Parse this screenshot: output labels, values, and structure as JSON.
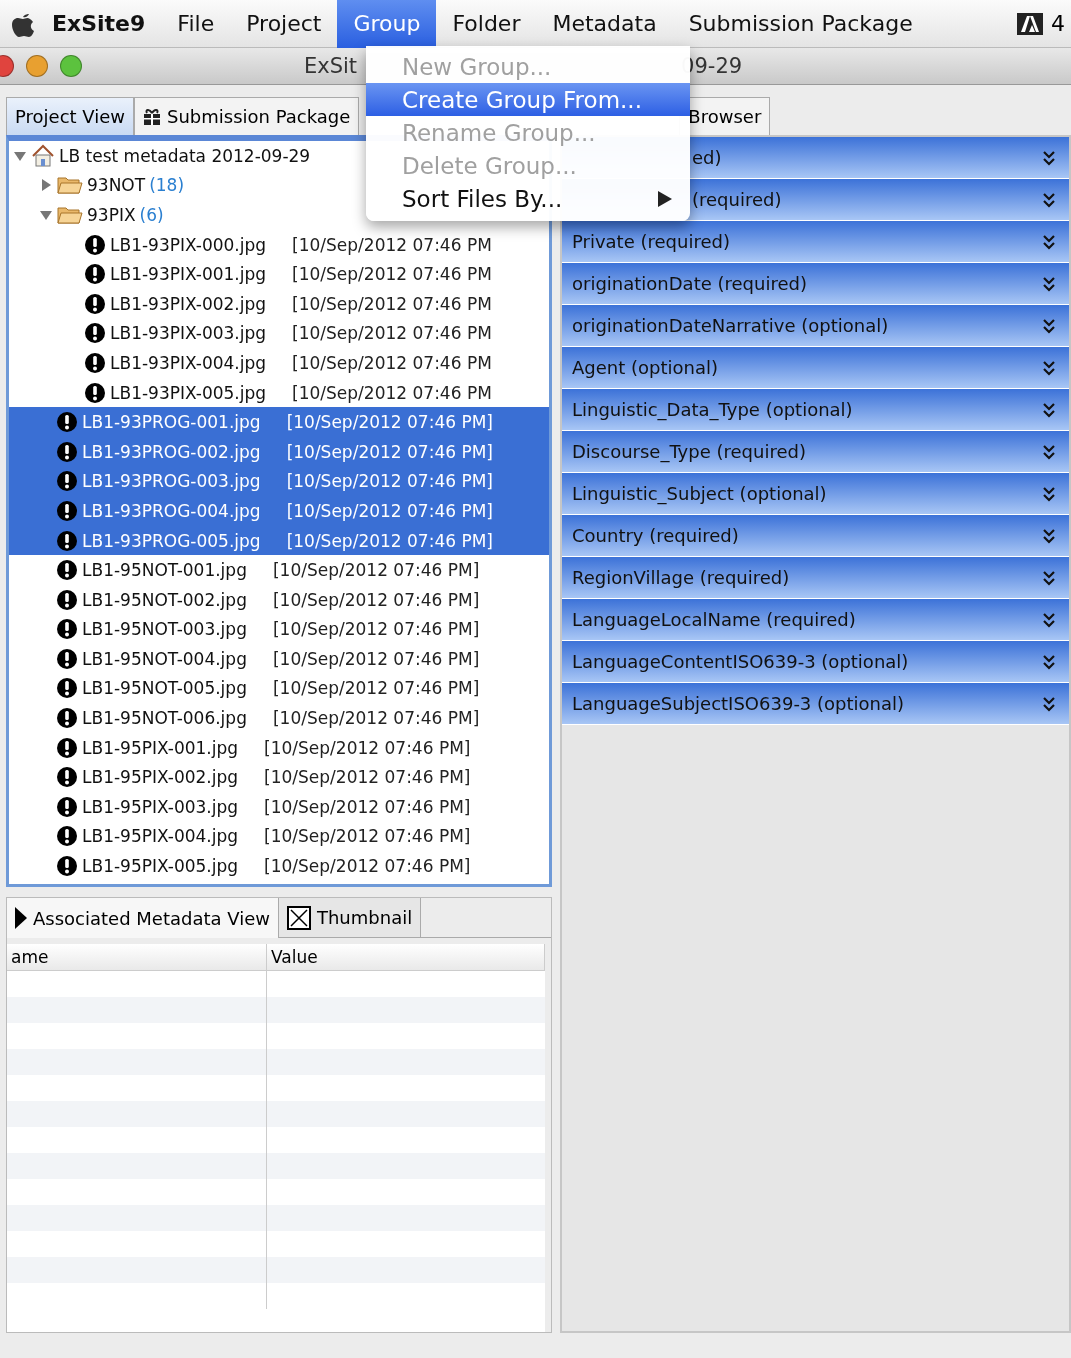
{
  "menu_bar": {
    "app_name": "ExSite9",
    "items": [
      {
        "label": "File",
        "selected": false
      },
      {
        "label": "Project",
        "selected": false
      },
      {
        "label": "Group",
        "selected": true
      },
      {
        "label": "Folder",
        "selected": false
      },
      {
        "label": "Metadata",
        "selected": false
      },
      {
        "label": "Submission Package",
        "selected": false
      }
    ],
    "status_text": "4"
  },
  "menu": {
    "items": [
      {
        "kind": "item",
        "label": "New Group...",
        "disabled": true,
        "selected": false
      },
      {
        "kind": "item",
        "label": "Create Group From...",
        "disabled": false,
        "selected": true
      },
      {
        "kind": "item",
        "label": "Rename Group...",
        "disabled": true,
        "selected": false
      },
      {
        "kind": "item",
        "label": "Delete Group...",
        "disabled": true,
        "selected": false
      },
      {
        "kind": "submenu",
        "label": "Sort Files By...",
        "disabled": false,
        "selected": false
      }
    ]
  },
  "window": {
    "title_left": "ExSit",
    "title_right": "09-29"
  },
  "tabs": [
    {
      "label": "Project View",
      "selected": true
    },
    {
      "label": "Submission Package",
      "selected": false
    },
    {
      "label": "Browser",
      "selected": false
    }
  ],
  "tree": {
    "label": "LB test metadata 2012-09-29",
    "expanded": true,
    "children": [
      {
        "kind": "folder",
        "label": "93NOT",
        "count": "(18)",
        "expanded": false
      },
      {
        "kind": "folder",
        "label": "93PIX",
        "count": "(6)",
        "expanded": true,
        "children": [
          {
            "kind": "file",
            "label": "LB1-93PIX-000.jpg",
            "date": "[10/Sep/2012 07:46 PM",
            "selected": false
          },
          {
            "kind": "file",
            "label": "LB1-93PIX-001.jpg",
            "date": "[10/Sep/2012 07:46 PM",
            "selected": false
          },
          {
            "kind": "file",
            "label": "LB1-93PIX-002.jpg",
            "date": "[10/Sep/2012 07:46 PM",
            "selected": false
          },
          {
            "kind": "file",
            "label": "LB1-93PIX-003.jpg",
            "date": "[10/Sep/2012 07:46 PM",
            "selected": false
          },
          {
            "kind": "file",
            "label": "LB1-93PIX-004.jpg",
            "date": "[10/Sep/2012 07:46 PM",
            "selected": false
          },
          {
            "kind": "file",
            "label": "LB1-93PIX-005.jpg",
            "date": "[10/Sep/2012 07:46 PM",
            "selected": false
          }
        ]
      },
      {
        "kind": "file",
        "label": "LB1-93PROG-001.jpg",
        "date": "[10/Sep/2012 07:46 PM]",
        "selected": true
      },
      {
        "kind": "file",
        "label": "LB1-93PROG-002.jpg",
        "date": "[10/Sep/2012 07:46 PM]",
        "selected": true
      },
      {
        "kind": "file",
        "label": "LB1-93PROG-003.jpg",
        "date": "[10/Sep/2012 07:46 PM]",
        "selected": true
      },
      {
        "kind": "file",
        "label": "LB1-93PROG-004.jpg",
        "date": "[10/Sep/2012 07:46 PM]",
        "selected": true
      },
      {
        "kind": "file",
        "label": "LB1-93PROG-005.jpg",
        "date": "[10/Sep/2012 07:46 PM]",
        "selected": true
      },
      {
        "kind": "file",
        "label": "LB1-95NOT-001.jpg",
        "date": "[10/Sep/2012 07:46 PM]",
        "selected": false
      },
      {
        "kind": "file",
        "label": "LB1-95NOT-002.jpg",
        "date": "[10/Sep/2012 07:46 PM]",
        "selected": false
      },
      {
        "kind": "file",
        "label": "LB1-95NOT-003.jpg",
        "date": "[10/Sep/2012 07:46 PM]",
        "selected": false
      },
      {
        "kind": "file",
        "label": "LB1-95NOT-004.jpg",
        "date": "[10/Sep/2012 07:46 PM]",
        "selected": false
      },
      {
        "kind": "file",
        "label": "LB1-95NOT-005.jpg",
        "date": "[10/Sep/2012 07:46 PM]",
        "selected": false
      },
      {
        "kind": "file",
        "label": "LB1-95NOT-006.jpg",
        "date": "[10/Sep/2012 07:46 PM]",
        "selected": false
      },
      {
        "kind": "file",
        "label": "LB1-95PIX-001.jpg",
        "date": "[10/Sep/2012 07:46 PM]",
        "selected": false
      },
      {
        "kind": "file",
        "label": "LB1-95PIX-002.jpg",
        "date": "[10/Sep/2012 07:46 PM]",
        "selected": false
      },
      {
        "kind": "file",
        "label": "LB1-95PIX-003.jpg",
        "date": "[10/Sep/2012 07:46 PM]",
        "selected": false
      },
      {
        "kind": "file",
        "label": "LB1-95PIX-004.jpg",
        "date": "[10/Sep/2012 07:46 PM]",
        "selected": false
      },
      {
        "kind": "file",
        "label": "LB1-95PIX-005.jpg",
        "date": "[10/Sep/2012 07:46 PM]",
        "selected": false
      }
    ]
  },
  "bottom_tabs": [
    {
      "label": "Associated Metadata View",
      "selected": true
    },
    {
      "label": "Thumbnail",
      "selected": false
    }
  ],
  "metadata_table": {
    "columns": [
      "ame",
      "Value"
    ]
  },
  "metadata_categories": [
    {
      "label": "ed)",
      "covered": true
    },
    {
      "label": "(required)",
      "covered": true
    },
    {
      "label": "Private (required)",
      "covered": false
    },
    {
      "label": "originationDate (required)",
      "covered": false
    },
    {
      "label": "originationDateNarrative (optional)",
      "covered": false
    },
    {
      "label": "Agent (optional)",
      "covered": false
    },
    {
      "label": "Linguistic_Data_Type (optional)",
      "covered": false
    },
    {
      "label": "Discourse_Type (required)",
      "covered": false
    },
    {
      "label": "Linguistic_Subject (optional)",
      "covered": false
    },
    {
      "label": "Country (required)",
      "covered": false
    },
    {
      "label": "RegionVillage (required)",
      "covered": false
    },
    {
      "label": "LanguageLocalName (required)",
      "covered": false
    },
    {
      "label": "LanguageContentISO639-3 (optional)",
      "covered": false
    },
    {
      "label": "LanguageSubjectISO639-3 (optional)",
      "covered": false
    }
  ]
}
